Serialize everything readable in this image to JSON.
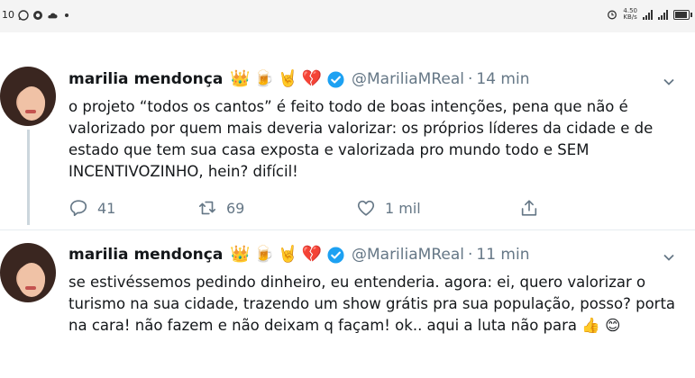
{
  "status_bar": {
    "left_text": "10",
    "net_speed": "4.50",
    "net_unit": "KB/s",
    "icons_left": [
      "whatsapp-icon",
      "chrome-icon",
      "cloud-icon",
      "dot-icon"
    ],
    "icons_right": [
      "alarm-icon",
      "signal-icon",
      "signal-icon",
      "battery-icon"
    ]
  },
  "tweets": [
    {
      "name": "marilia mendonça",
      "emojis": [
        "👑",
        "🍺",
        "🤘",
        "💔"
      ],
      "handle": "@MariliaMReal",
      "dot": "·",
      "time": "14 min",
      "text": "o projeto “todos os cantos” é feito todo de boas intenções, pena que não é valorizado por quem mais deveria valorizar: os próprios líderes da cidade e de estado que tem sua casa exposta e valorizada pro mundo todo e SEM INCENTIVOZINHO, hein? difícil!",
      "replies": "41",
      "retweets": "69",
      "likes": "1 mil"
    },
    {
      "name": "marilia mendonça",
      "emojis": [
        "👑",
        "🍺",
        "🤘",
        "💔"
      ],
      "handle": "@MariliaMReal",
      "dot": "·",
      "time": "11 min",
      "text": "se estivéssemos pedindo dinheiro, eu entenderia. agora: ei, quero valorizar o turismo na sua cidade, trazendo um show grátis pra sua população, posso? porta na cara! não fazem e não deixam q façam! ok.. aqui a luta não para 👍 😊"
    }
  ],
  "colors": {
    "text": "#14171a",
    "secondary": "#657786",
    "verified": "#1da1f2",
    "divider": "#e6ecf0"
  }
}
